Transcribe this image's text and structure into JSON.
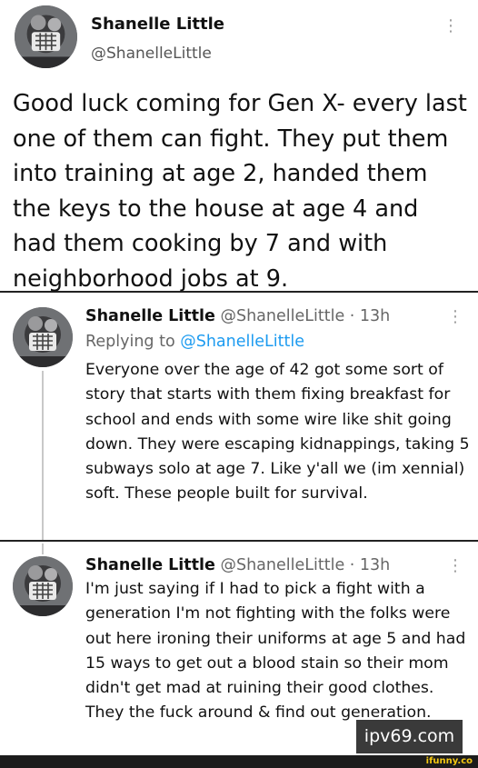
{
  "main_tweet": {
    "display_name": "Shanelle Little",
    "handle": "@ShanelleLittle",
    "more_icon": "⋮",
    "text": "Good luck coming for Gen X- every last one of them can fight. They put them into training at age 2, handed them the keys to the house at age 4 and had them cooking by 7 and with neighborhood jobs at 9."
  },
  "reply1": {
    "display_name": "Shanelle Little",
    "meta": " @ShanelleLittle · 13h",
    "replying_to_label": "Replying to ",
    "replying_to_handle": "@ShanelleLittle",
    "more_icon": "⋮",
    "text": "Everyone over the age of 42 got some sort of story that starts with them fixing breakfast for school and ends with some wire like shit going down.  They were escaping kidnappings, taking 5 subways solo at age 7. Like y'all we (im xennial) soft.  These people built for survival."
  },
  "reply2": {
    "display_name": "Shanelle Little",
    "meta": " @ShanelleLittle · 13h",
    "more_icon": "⋮",
    "text": "I'm just saying if I had to pick a fight with a generation I'm not fighting with the folks were out here ironing their uniforms at age 5 and had 15 ways to get out a blood stain so their mom didn't get mad at ruining their good clothes. They the fuck around & find out generation."
  },
  "watermark": "ipv69.com",
  "footer_logo": "ifunny.co",
  "colors": {
    "link": "#1d9bf0",
    "meta_gray": "#666666",
    "watermark_bg": "#3a3a3a",
    "footer_bg": "#1c1c1c",
    "ifunny_yellow": "#f3c712"
  }
}
